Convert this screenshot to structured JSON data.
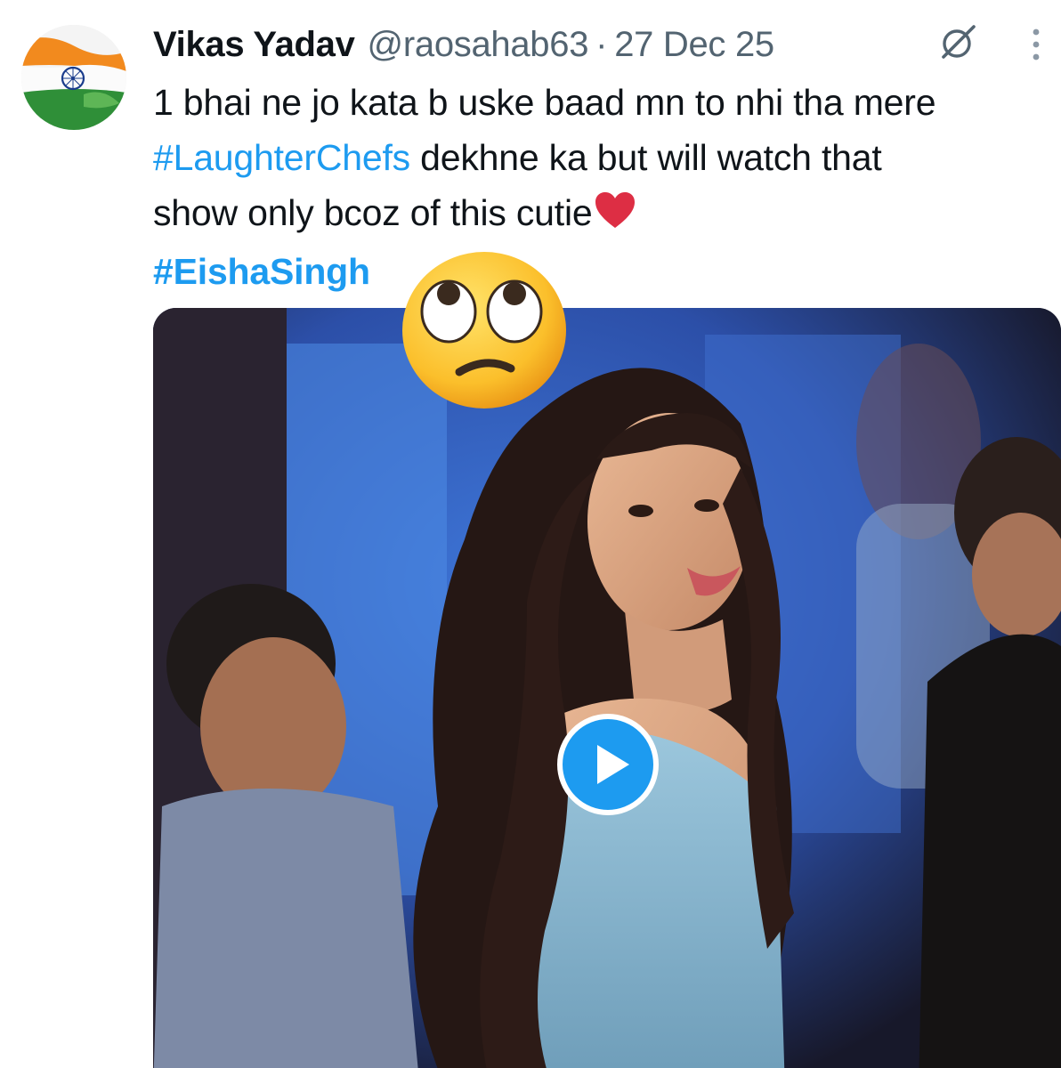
{
  "post": {
    "author_name": "Vikas Yadav",
    "handle": "@raosahab63",
    "separator": "·",
    "date": "27 Dec 25",
    "text": {
      "line1": "1 bhai ne jo kata b uske baad mn to nhi tha mere",
      "hashtag1": "#LaughterChefs",
      "line2_rest": " dekhne ka but will watch that",
      "line3": "show only bcoz of this cutie",
      "hashtag2": "#EishaSingh"
    },
    "icons": {
      "avatar": "india-flag-avatar",
      "grok": "grok-icon",
      "more": "more-vertical-icon",
      "heart": "red-heart-emoji",
      "overlay_emoji": "face-with-rolling-eyes-emoji",
      "play": "play-icon"
    }
  },
  "colors": {
    "name": "#0f1419",
    "meta": "#536471",
    "hashtag": "#1d9bf0",
    "play_button": "#1d9bf0"
  }
}
